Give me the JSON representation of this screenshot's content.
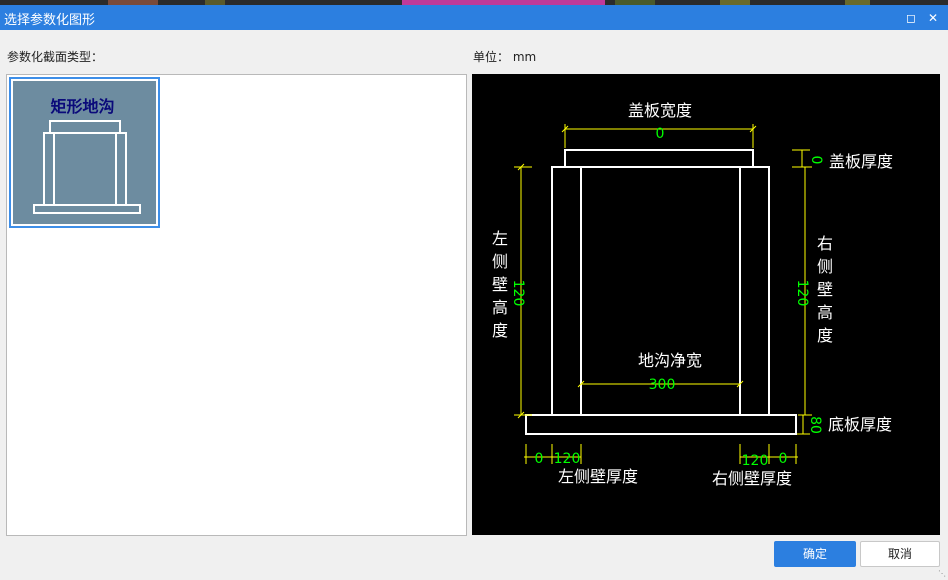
{
  "window": {
    "title": "选择参数化图形"
  },
  "left": {
    "label": "参数化截面类型：",
    "items": [
      {
        "label": "矩形地沟"
      }
    ]
  },
  "unit": {
    "label": "单位：",
    "value": "mm"
  },
  "diagram": {
    "cover_width_label": "盖板宽度",
    "cover_width_value": "0",
    "cover_thick_label": "盖板厚度",
    "cover_thick_value": "0",
    "left_wall_h_label": [
      "左",
      "侧",
      "壁",
      "高",
      "度"
    ],
    "left_wall_h_value": "120",
    "right_wall_h_label": [
      "右",
      "侧",
      "壁",
      "高",
      "度"
    ],
    "right_wall_h_value": "120",
    "net_width_label": "地沟净宽",
    "net_width_value": "300",
    "bottom_thick_label": "底板厚度",
    "bottom_thick_value": "80",
    "left_wall_t_label": "左侧壁厚度",
    "left_offset_value": "0",
    "left_wall_t_value": "120",
    "right_wall_t_label": "右侧壁厚度",
    "right_wall_t_value": "120",
    "right_offset_value": "0"
  },
  "buttons": {
    "ok": "确定",
    "cancel": "取消"
  },
  "colors": {
    "titlebar": "#2c7fe0",
    "dim_line": "#ffff00",
    "dim_text": "#00ff00",
    "outline": "#ffffff"
  }
}
